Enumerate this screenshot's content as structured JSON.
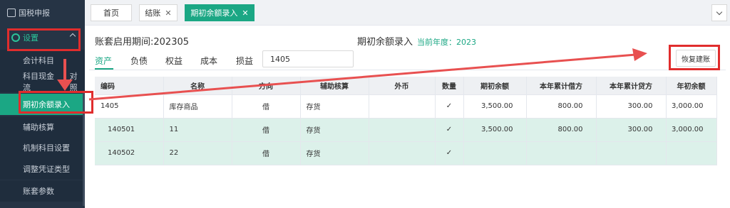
{
  "sidebar": {
    "top_item": "国税申报",
    "group": "设置",
    "items": [
      "会计科目",
      "科目现金流",
      "期初余额录入",
      "辅助核算",
      "机制科目设置",
      "调整凭证类型",
      "账套参数"
    ],
    "item_overlap_suffix": "对照"
  },
  "tabs": [
    {
      "label": "首页",
      "closable": false
    },
    {
      "label": "结账",
      "closable": true
    },
    {
      "label": "期初余额录入",
      "closable": true
    }
  ],
  "header": {
    "start_label": "账套启用期间:202305",
    "page_title": "期初余额录入",
    "current_year": "当前年度：2023"
  },
  "subtabs": [
    "资产",
    "负债",
    "权益",
    "成本",
    "损益"
  ],
  "search": {
    "value": "1405"
  },
  "restore_button": "恢复建账",
  "table": {
    "columns": [
      "编码",
      "名称",
      "方向",
      "辅助核算",
      "外币",
      "数量",
      "期初余额",
      "本年累计借方",
      "本年累计贷方",
      "年初余额"
    ],
    "rows": [
      {
        "code": "1405",
        "name": "库存商品",
        "dir": "借",
        "aux": "存货",
        "fx": "",
        "qty": "✓",
        "opening": "3,500.00",
        "debit": "800.00",
        "credit": "300.00",
        "year_open": "3,000.00",
        "highlight": false
      },
      {
        "code": "140501",
        "name": "11",
        "dir": "借",
        "aux": "存货",
        "fx": "",
        "qty": "✓",
        "opening": "3,500.00",
        "debit": "800.00",
        "credit": "300.00",
        "year_open": "3,000.00",
        "highlight": true
      },
      {
        "code": "140502",
        "name": "22",
        "dir": "借",
        "aux": "存货",
        "fx": "",
        "qty": "✓",
        "opening": "",
        "debit": "",
        "credit": "",
        "year_open": "",
        "highlight": true
      }
    ]
  },
  "colors": {
    "accent": "#1ba784",
    "sidebar_bg": "#263445",
    "annotation_red": "#e02d2d",
    "row_highlight": "#dcf1ea"
  }
}
